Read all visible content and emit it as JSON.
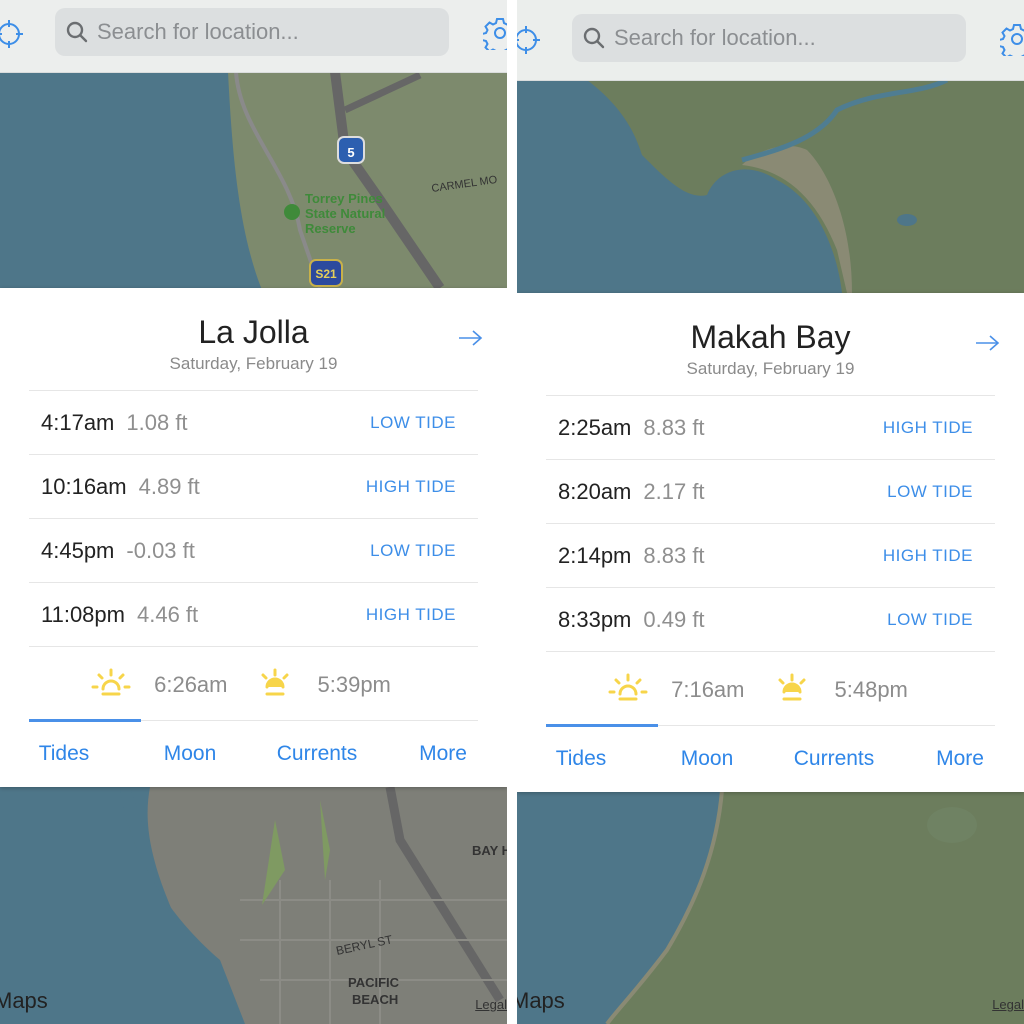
{
  "colors": {
    "accent": "#3d8ee8",
    "sun": "#f7d54a",
    "water": "#4e7689",
    "land": "#6d7f5e"
  },
  "panels": [
    {
      "search_placeholder": "Search for location...",
      "location": "La Jolla",
      "date": "Saturday, February 19",
      "tides": [
        {
          "time": "4:17am",
          "height": "1.08 ft",
          "type": "LOW TIDE"
        },
        {
          "time": "10:16am",
          "height": "4.89 ft",
          "type": "HIGH TIDE"
        },
        {
          "time": "4:45pm",
          "height": "-0.03 ft",
          "type": "LOW TIDE"
        },
        {
          "time": "11:08pm",
          "height": "4.46 ft",
          "type": "HIGH TIDE"
        }
      ],
      "sunrise": "6:26am",
      "sunset": "5:39pm",
      "tabs": [
        "Tides",
        "Moon",
        "Currents",
        "More"
      ],
      "active_tab": "Tides",
      "map_labels": [
        "Torrey Pines State Natural Reserve",
        "CARMEL MO",
        "5",
        "S21",
        "BAY H",
        "BERYL ST",
        "PACIFIC BEACH"
      ],
      "maps_attribution": "Maps",
      "legal": "Legal"
    },
    {
      "search_placeholder": "Search for location...",
      "location": "Makah Bay",
      "date": "Saturday, February 19",
      "tides": [
        {
          "time": "2:25am",
          "height": "8.83 ft",
          "type": "HIGH TIDE"
        },
        {
          "time": "8:20am",
          "height": "2.17 ft",
          "type": "LOW TIDE"
        },
        {
          "time": "2:14pm",
          "height": "8.83 ft",
          "type": "HIGH TIDE"
        },
        {
          "time": "8:33pm",
          "height": "0.49 ft",
          "type": "LOW TIDE"
        }
      ],
      "sunrise": "7:16am",
      "sunset": "5:48pm",
      "tabs": [
        "Tides",
        "Moon",
        "Currents",
        "More"
      ],
      "active_tab": "Tides",
      "maps_attribution": "Maps",
      "legal": "Legal"
    }
  ]
}
